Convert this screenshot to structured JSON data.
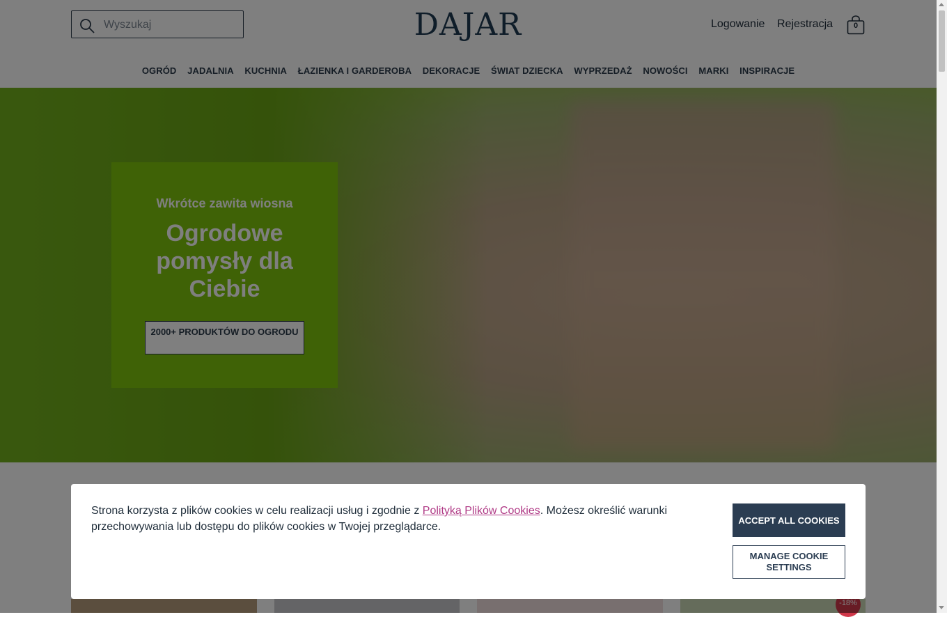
{
  "header": {
    "search_placeholder": "Wyszukaj",
    "logo": "DAJAR",
    "login": "Logowanie",
    "register": "Rejestracja",
    "cart_count": "0"
  },
  "nav": {
    "items": [
      "OGRÓD",
      "JADALNIA",
      "KUCHNIA",
      "ŁAZIENKA I GARDEROBA",
      "DEKORACJE",
      "ŚWIAT DZIECKA",
      "WYPRZEDAŻ",
      "NOWOŚCI",
      "MARKI",
      "INSPIRACJE"
    ]
  },
  "hero": {
    "eyebrow": "Wkrótce zawita wiosna",
    "title": "Ogrodowe pomysły dla Ciebie",
    "cta": "2000+ PRODUKTÓW DO OGRODU"
  },
  "products": {
    "discount_badge": "-18%"
  },
  "cookie": {
    "text_before": "Strona korzysta z plików cookies w celu realizacji usług i zgodnie z ",
    "link": "Polityką Plików Cookies",
    "text_after": ". Możesz określić warunki przechowywania lub dostępu do plików cookies w Twojej przeglądarce.",
    "accept": "ACCEPT ALL COOKIES",
    "manage": "MANAGE COOKIE SETTINGS"
  },
  "colors": {
    "brand": "#1f3a52",
    "hero_card": "#7ec50c",
    "accept_button": "#2b3d52",
    "cookie_link": "#b03a86",
    "discount_badge": "#d1384a"
  }
}
